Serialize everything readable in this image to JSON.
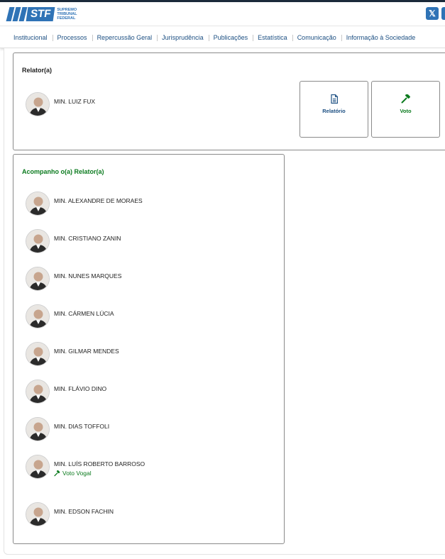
{
  "header": {
    "logo_text": "STF",
    "logo_sub": [
      "SUPREMO",
      "TRIBUNAL",
      "FEDERAL"
    ]
  },
  "nav": [
    "Institucional",
    "Processos",
    "Repercussão Geral",
    "Jurisprudência",
    "Publicações",
    "Estatística",
    "Comunicação",
    "Informação à Sociedade"
  ],
  "relator": {
    "title": "Relator(a)",
    "minister": "MIN. LUIZ FUX",
    "actions": [
      {
        "label": "Relatório",
        "icon": "document-icon",
        "color": "#1c4f82"
      },
      {
        "label": "Voto",
        "icon": "gavel-icon",
        "color": "#0c7b1f"
      }
    ]
  },
  "acompanha": {
    "title": "Acompanho o(a) Relator(a)",
    "ministers": [
      {
        "name": "MIN. ALEXANDRE DE MORAES"
      },
      {
        "name": "MIN. CRISTIANO ZANIN"
      },
      {
        "name": "MIN. NUNES MARQUES"
      },
      {
        "name": "MIN. CÁRMEN LÚCIA"
      },
      {
        "name": "MIN. GILMAR MENDES"
      },
      {
        "name": "MIN. FLÁVIO DINO"
      },
      {
        "name": "MIN. DIAS TOFFOLI"
      },
      {
        "name": "MIN. LUÍS ROBERTO BARROSO",
        "vote": "Voto Vogal"
      },
      {
        "name": "MIN. EDSON FACHIN"
      }
    ]
  },
  "colors": {
    "accent": "#2f73b6",
    "nav_text": "#1c4f82",
    "green": "#0c7b1f",
    "border": "#8a8a8a"
  }
}
